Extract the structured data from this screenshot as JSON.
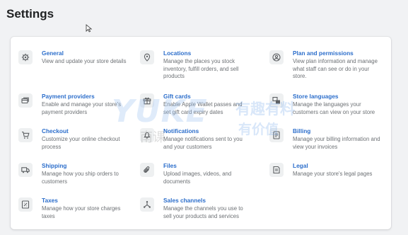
{
  "page": {
    "title": "Settings"
  },
  "items": [
    {
      "id": "general",
      "title": "General",
      "desc": "View and update your store details",
      "icon": "gear-icon"
    },
    {
      "id": "payment-providers",
      "title": "Payment providers",
      "desc": "Enable and manage your store's payment providers",
      "icon": "payment-icon"
    },
    {
      "id": "checkout",
      "title": "Checkout",
      "desc": "Customize your online checkout process",
      "icon": "cart-icon"
    },
    {
      "id": "shipping",
      "title": "Shipping",
      "desc": "Manage how you ship orders to customers",
      "icon": "truck-icon"
    },
    {
      "id": "taxes",
      "title": "Taxes",
      "desc": "Manage how your store charges taxes",
      "icon": "tax-icon"
    },
    {
      "id": "locations",
      "title": "Locations",
      "desc": "Manage the places you stock inventory, fulfill orders, and sell products",
      "icon": "location-icon"
    },
    {
      "id": "gift-cards",
      "title": "Gift cards",
      "desc": "Enable Apple Wallet passes and set gift card expiry dates",
      "icon": "gift-icon"
    },
    {
      "id": "notifications",
      "title": "Notifications",
      "desc": "Manage notifications sent to you and your customers",
      "icon": "bell-icon"
    },
    {
      "id": "files",
      "title": "Files",
      "desc": "Upload images, videos, and documents",
      "icon": "paperclip-icon"
    },
    {
      "id": "sales-channels",
      "title": "Sales channels",
      "desc": "Manage the channels you use to sell your products and services",
      "icon": "channels-icon"
    },
    {
      "id": "plan-and-permissions",
      "title": "Plan and permissions",
      "desc": "View plan information and manage what staff can see or do in your store.",
      "icon": "user-icon"
    },
    {
      "id": "store-languages",
      "title": "Store languages",
      "desc": "Manage the languages your customers can view on your store",
      "icon": "languages-icon"
    },
    {
      "id": "billing",
      "title": "Billing",
      "desc": "Manage your billing information and view your invoices",
      "icon": "billing-icon"
    },
    {
      "id": "legal",
      "title": "Legal",
      "desc": "Manage your store's legal pages",
      "icon": "legal-icon"
    }
  ],
  "watermark": {
    "latin": "YUKE",
    "cjk_1": "有趣有料",
    "cjk_2": "有价值",
    "cjk_3": "南课"
  },
  "colors": {
    "link": "#2c6ecb",
    "text": "#202223",
    "subdued": "#6d7175",
    "icon_bg": "#eef0f1",
    "page_bg": "#f1f2f4"
  }
}
